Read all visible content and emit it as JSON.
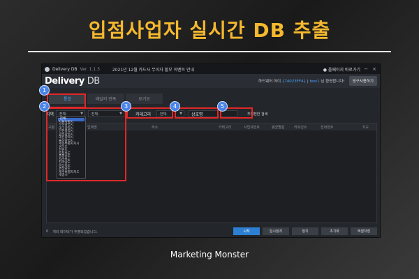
{
  "headline": "입점사업자 실시간 DB 추출",
  "footer": "Marketing Monster",
  "window": {
    "app_title": "Delivery DB",
    "version": "Ver. 1.1.3",
    "notice": "2021년 12월 카드사 무이자 할부 이벤트 안내",
    "pin_label": "● 올페이지 바로가기",
    "brand_main": "Delivery",
    "brand_sub": "DB",
    "hwid_prefix": "하드웨어 아이",
    "hwid_value": "{74023FF4}",
    "user_id": "test1",
    "greeting": "님 환영합니다!",
    "purchase_button": "영구사용하기"
  },
  "tabs": [
    {
      "label": "통합",
      "active": true
    },
    {
      "label": "배달의 민족",
      "active": false
    },
    {
      "label": "요기요",
      "active": false
    }
  ],
  "filters": {
    "region_label": "지역",
    "region_select": "-전체-",
    "district_select": "-전체-",
    "category_label": "카테고리",
    "category_select": "-전체-",
    "name_label": "상호명",
    "search_button": "추대전한 검색"
  },
  "region_options": [
    "-전체-",
    "서울특별시",
    "부산광역시",
    "대구광역시",
    "인천광역시",
    "광주광역시",
    "대전광역시",
    "울산광역시",
    "세종특별자치시",
    "경기도",
    "강원도",
    "충청북도",
    "충청남도",
    "전라북도",
    "전라남도",
    "경상북도",
    "경상남도",
    "제주특별자치도",
    "세종시"
  ],
  "table_headers": [
    "구분",
    "업체명",
    "주소",
    "카테고리",
    "사업자번호",
    "평균별점",
    "리뷰건수",
    "전화번호",
    "지도"
  ],
  "bottom": {
    "status_text": "개의 데이터가 추출되었습니다.",
    "count": "0",
    "buttons": [
      "시작",
      "일시정지",
      "정지",
      "초기화",
      "엑셀저장"
    ]
  },
  "badges": [
    "1",
    "2",
    "3",
    "4",
    "5"
  ],
  "colors": {
    "headline": "#f5b82e",
    "highlight_box": "#e02828",
    "badge": "#4a86e8",
    "accent": "#4aa3ff"
  }
}
